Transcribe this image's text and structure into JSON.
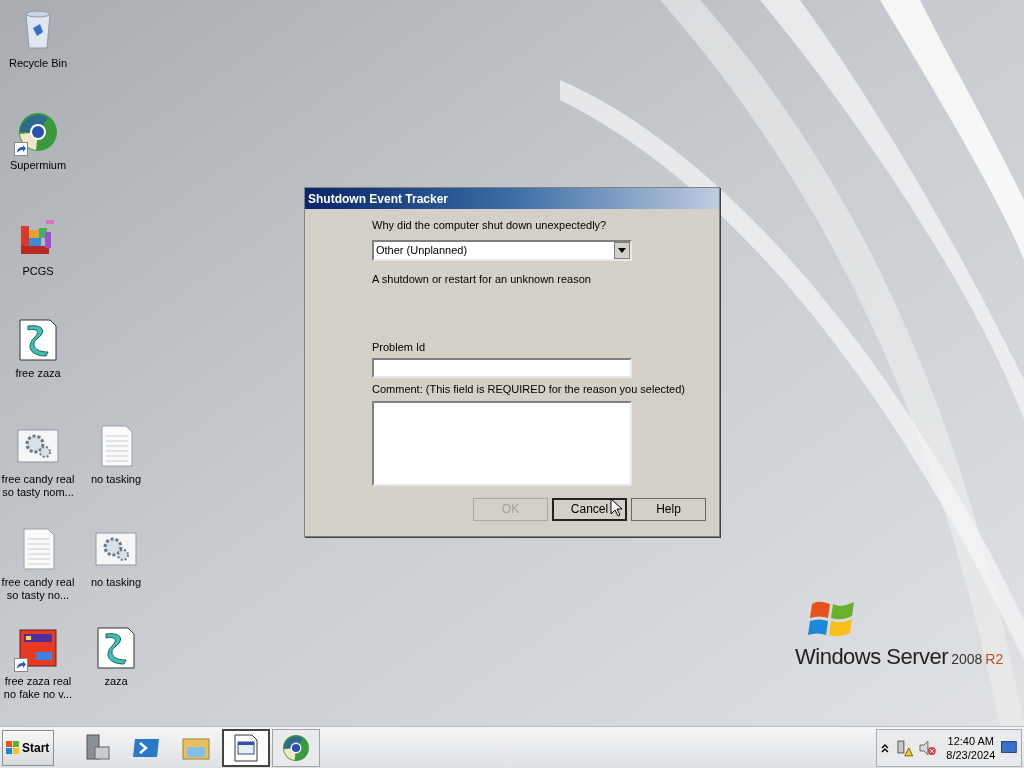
{
  "desktop": {
    "icons": [
      {
        "label": "Recycle Bin",
        "kind": "recycle",
        "shortcut": false
      },
      {
        "label": "Supermium",
        "kind": "browser",
        "shortcut": true
      },
      {
        "label": "PCGS",
        "kind": "blocks",
        "shortcut": false
      },
      {
        "label": "free zaza",
        "kind": "script",
        "shortcut": false
      },
      {
        "label": "free candy real so tasty nom...",
        "kind": "gear",
        "shortcut": false
      },
      {
        "label": "no tasking",
        "kind": "document",
        "shortcut": false
      },
      {
        "label": "free candy real so tasty no...",
        "kind": "document",
        "shortcut": false
      },
      {
        "label": "no tasking",
        "kind": "gear",
        "shortcut": false
      },
      {
        "label": "free zaza real no fake no v...",
        "kind": "game",
        "shortcut": true
      },
      {
        "label": "zaza",
        "kind": "script",
        "shortcut": false
      }
    ]
  },
  "branding": {
    "product": "Windows Server",
    "version": "2008",
    "edition": "R2"
  },
  "dialog": {
    "title": "Shutdown Event Tracker",
    "question": "Why did the computer shut down unexpectedly?",
    "reason": {
      "value": "Other (Unplanned)"
    },
    "description": "A shutdown or restart for an unknown reason",
    "problem_id": {
      "label": "Problem Id"
    },
    "comment": {
      "label": "Comment: (This field is REQUIRED for the reason you selected)"
    },
    "buttons": [
      {
        "label": "OK",
        "disabled": true,
        "focused": false
      },
      {
        "label": "Cancel",
        "disabled": false,
        "focused": true
      },
      {
        "label": "Help",
        "disabled": false,
        "focused": false
      }
    ]
  },
  "taskbar": {
    "start": "Start",
    "items": [
      {
        "kind": "server",
        "selected": false
      },
      {
        "kind": "powershell",
        "selected": false
      },
      {
        "kind": "folder",
        "selected": false
      },
      {
        "kind": "window",
        "selected": true
      },
      {
        "kind": "browser",
        "selected": false
      }
    ],
    "tray": {
      "time": "12:40 AM",
      "date": "8/23/2024"
    }
  }
}
